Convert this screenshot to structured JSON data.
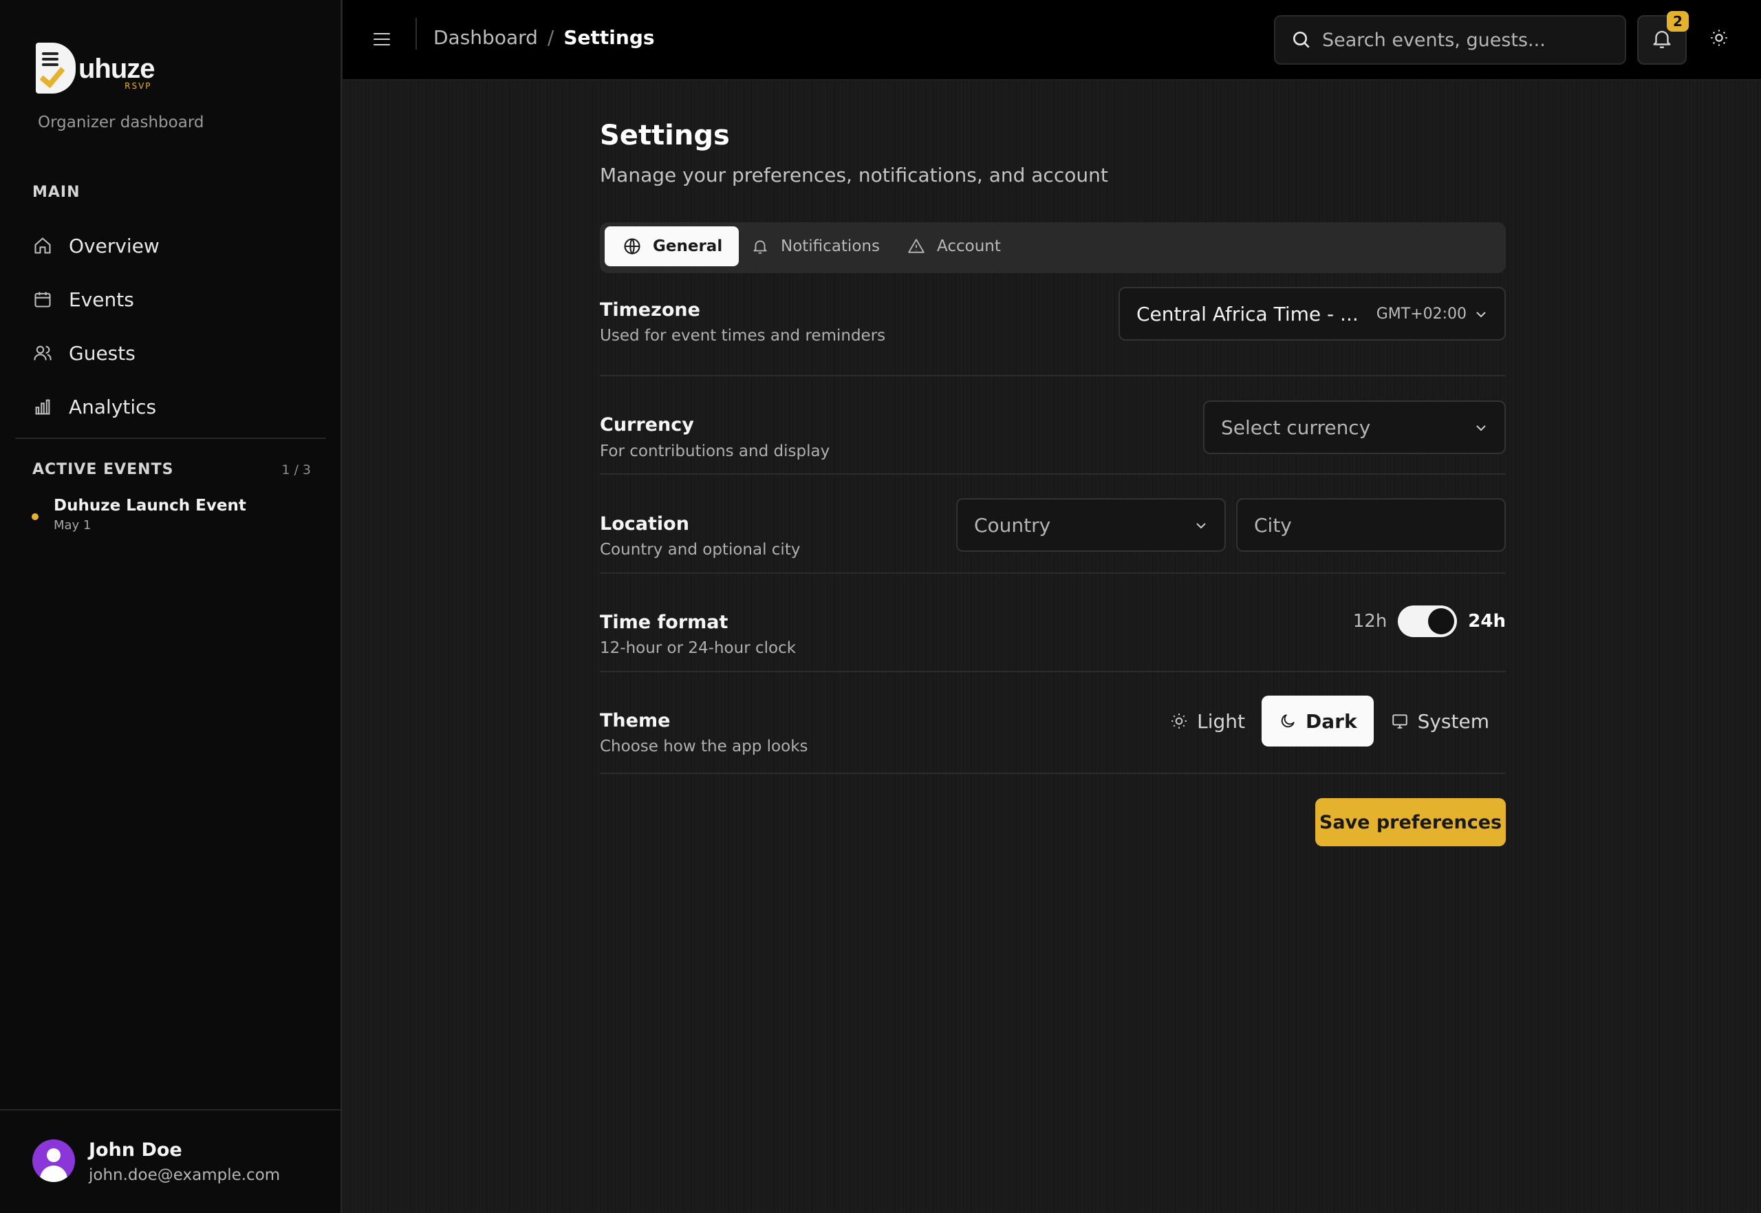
{
  "app": {
    "logo_text": "uhuze",
    "logo_sub": "RSVP",
    "subtitle": "Organizer dashboard"
  },
  "sidebar": {
    "main_label": "MAIN",
    "items": [
      {
        "label": "Overview",
        "icon": "home-icon"
      },
      {
        "label": "Events",
        "icon": "calendar-icon"
      },
      {
        "label": "Guests",
        "icon": "users-icon"
      },
      {
        "label": "Analytics",
        "icon": "bar-chart-icon"
      }
    ],
    "active_events": {
      "label": "ACTIVE EVENTS",
      "count": "1 / 3",
      "items": [
        {
          "name": "Duhuze Launch Event",
          "date": "May 1"
        }
      ]
    },
    "user": {
      "name": "John Doe",
      "email": "john.doe@example.com"
    }
  },
  "topbar": {
    "breadcrumb": [
      "Dashboard",
      "Settings"
    ],
    "breadcrumb_sep": "/",
    "search_placeholder": "Search events, guests...",
    "notification_count": "2"
  },
  "page": {
    "title": "Settings",
    "subtitle": "Manage your preferences, notifications, and account"
  },
  "tabs": [
    {
      "label": "General",
      "icon": "globe-icon",
      "active": true
    },
    {
      "label": "Notifications",
      "icon": "bell-icon",
      "active": false
    },
    {
      "label": "Account",
      "icon": "warning-icon",
      "active": false
    }
  ],
  "settings": {
    "timezone": {
      "title": "Timezone",
      "desc": "Used for event times and reminders",
      "value": "Central Africa Time - ...",
      "offset": "GMT+02:00"
    },
    "currency": {
      "title": "Currency",
      "desc": "For contributions and display",
      "placeholder": "Select currency"
    },
    "location": {
      "title": "Location",
      "desc": "Country and optional city",
      "country_placeholder": "Country",
      "city_placeholder": "City"
    },
    "time_format": {
      "title": "Time format",
      "desc": "12-hour or 24-hour clock",
      "left": "12h",
      "right": "24h",
      "selected": "24h"
    },
    "theme": {
      "title": "Theme",
      "desc": "Choose how the app looks",
      "options": [
        {
          "label": "Light",
          "icon": "sun-icon"
        },
        {
          "label": "Dark",
          "icon": "moon-icon"
        },
        {
          "label": "System",
          "icon": "monitor-icon"
        }
      ],
      "selected": "Dark"
    }
  },
  "actions": {
    "save_label": "Save preferences"
  },
  "colors": {
    "accent": "#e5b22e",
    "sidebar_bg": "#0b0b0b",
    "main_bg": "#1b1b1b",
    "avatar": "#8a36d8"
  }
}
